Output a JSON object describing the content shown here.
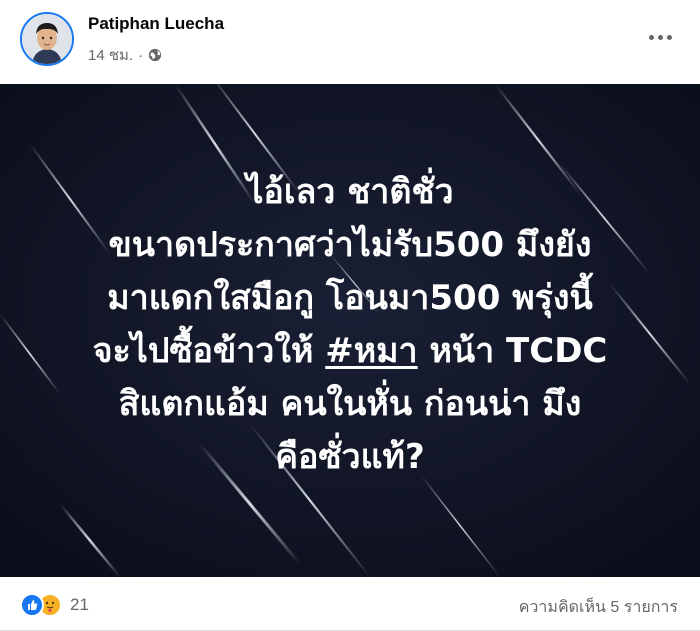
{
  "post": {
    "author_name": "Patiphan Luecha",
    "timestamp": "14 ชม.",
    "separator": "·",
    "privacy_icon": "globe-icon",
    "more_icon": "more-options-icon",
    "image_text": {
      "line1": "ไอ้เลว ชาติชั่ว",
      "line2": "ขนาดประกาศว่าไม่รับ500 มึงยัง",
      "line3": "มาแดกใสมือกู โอนมา500 พรุ่งนี้",
      "line4_before": "จะไปซื้อข้าวให้ ",
      "line4_hashtag": "#หมา",
      "line4_after": " หน้า TCDC",
      "line5": "สิแตกแอ้ม คนในหั่น ก่อนน่า มึง",
      "line6": "คือซั่วแท้?"
    },
    "colors": {
      "image_background": "#0f1324",
      "text": "#ffffff",
      "like_blue": "#1877f2",
      "care_yellow": "#f7b125"
    }
  },
  "footer": {
    "reaction_icons": [
      "like-icon",
      "care-icon"
    ],
    "reaction_count": "21",
    "comment_count_text": "ความคิดเห็น 5 รายการ"
  }
}
